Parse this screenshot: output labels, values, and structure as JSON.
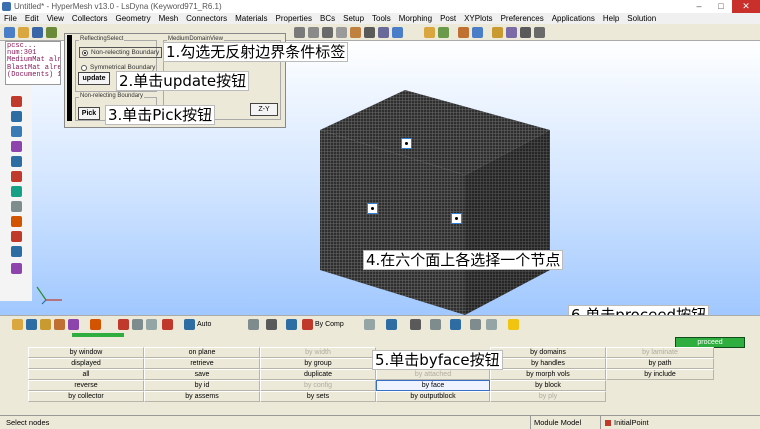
{
  "window": {
    "title": "Untitled* - HyperMesh v13.0 - LsDyna (Keyword971_R6.1)",
    "controls": [
      "–",
      "□",
      "✕"
    ]
  },
  "menu": [
    "File",
    "Edit",
    "View",
    "Collectors",
    "Geometry",
    "Mesh",
    "Connectors",
    "Materials",
    "Properties",
    "BCs",
    "Setup",
    "Tools",
    "Morphing",
    "Post",
    "XYPlots",
    "Preferences",
    "Applications",
    "Help",
    "Solution"
  ],
  "console": {
    "lines": [
      "pcsc...",
      "num:301",
      "MediumMat alre",
      "BlastMat alrea",
      "(Documents) 1"
    ]
  },
  "panel": {
    "reflecting_caption": "ReflectingSelect",
    "option1": "Non-relecting Boundary",
    "option2": "Symmetrical  Boundary",
    "update_label": "update",
    "nonrel_caption": "Non-relecting Boundary",
    "pick_label": "Pick",
    "medium_caption": "MediumDomainView",
    "zy_label": "Z-Y"
  },
  "annotations": {
    "a1": "1.勾选无反射边界条件标签",
    "a2": "2.单击update按钮",
    "a3": "3.单击Pick按钮",
    "a4": "4.在六个面上各选择一个节点",
    "a5": "5.单击byface按钮",
    "a6": "6.单击proceed按钮"
  },
  "bottom_toolbar": {
    "auto_label": "Auto",
    "bycomp_label": "By Comp"
  },
  "selection": {
    "proceed_label": "proceed",
    "col1": [
      "by window",
      "displayed",
      "all",
      "reverse",
      "by collector"
    ],
    "col2": [
      "on plane",
      "retrieve",
      "save",
      "by id",
      "by assems"
    ],
    "col3": [
      "by width",
      "by group",
      "duplicate",
      "by config",
      "by sets"
    ],
    "col4": [
      "by attached",
      "by face",
      "by outputblock"
    ],
    "col5": [
      "by domains",
      "by handles",
      "by morph vols",
      "by block",
      "by ply"
    ],
    "col6": [
      "by laminate",
      "by path",
      "by include"
    ]
  },
  "status": {
    "left": "Select nodes",
    "model": "Module Model",
    "component": "InitialPoint"
  },
  "colors": {
    "proceed": "#2fae3f",
    "annotation_bg": "#ffffff",
    "node_box": "#2f7fd8",
    "mesh": "#3c3c3c"
  }
}
